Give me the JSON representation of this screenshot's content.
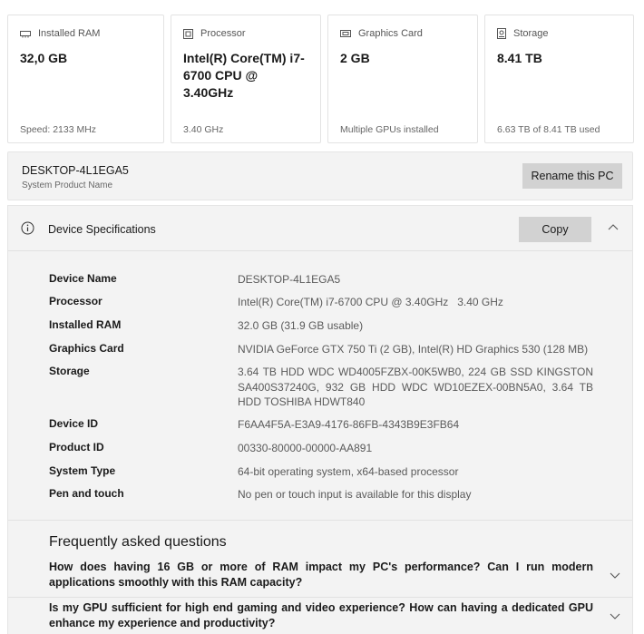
{
  "cards": [
    {
      "title": "Installed RAM",
      "icon": "ram-icon",
      "value": "32,0 GB",
      "sub": "Speed: 2133 MHz"
    },
    {
      "title": "Processor",
      "icon": "processor-icon",
      "value": "Intel(R) Core(TM) i7-6700 CPU @ 3.40GHz",
      "sub": "3.40 GHz"
    },
    {
      "title": "Graphics Card",
      "icon": "graphics-card-icon",
      "value": "2 GB",
      "sub": "Multiple GPUs installed"
    },
    {
      "title": "Storage",
      "icon": "storage-icon",
      "value": "8.41 TB",
      "sub": "6.63 TB of 8.41 TB used"
    }
  ],
  "pc": {
    "name": "DESKTOP-4L1EGA5",
    "name_label": "System Product Name",
    "rename_label": "Rename this PC"
  },
  "specs": {
    "title": "Device Specifications",
    "copy_label": "Copy",
    "rows": [
      {
        "label": "Device Name",
        "value": "DESKTOP-4L1EGA5"
      },
      {
        "label": "Processor",
        "value": "Intel(R) Core(TM) i7-6700 CPU @ 3.40GHz   3.40 GHz"
      },
      {
        "label": "Installed RAM",
        "value": "32.0 GB (31.9 GB usable)"
      },
      {
        "label": "Graphics Card",
        "value": "NVIDIA GeForce GTX 750 Ti (2 GB), Intel(R) HD Graphics 530 (128 MB)"
      },
      {
        "label": "Storage",
        "value": "3.64 TB HDD WDC WD4005FZBX-00K5WB0, 224 GB SSD KINGSTON SA400S37240G, 932 GB HDD WDC WD10EZEX-00BN5A0, 3.64 TB HDD TOSHIBA HDWT840"
      },
      {
        "label": "Device ID",
        "value": "F6AA4F5A-E3A9-4176-86FB-4343B9E3FB64"
      },
      {
        "label": "Product ID",
        "value": "00330-80000-00000-AA891"
      },
      {
        "label": "System Type",
        "value": "64-bit operating system, x64-based processor"
      },
      {
        "label": "Pen and touch",
        "value": "No pen or touch input is available for this display"
      }
    ]
  },
  "faq": {
    "title": "Frequently asked questions",
    "items": [
      {
        "question": "How does having 16 GB or more of RAM impact my PC's performance? Can I run modern applications smoothly with this RAM capacity?"
      },
      {
        "question": "Is my GPU sufficient for high end gaming and video experience? How can having a dedicated GPU enhance my experience and productivity?"
      }
    ]
  }
}
